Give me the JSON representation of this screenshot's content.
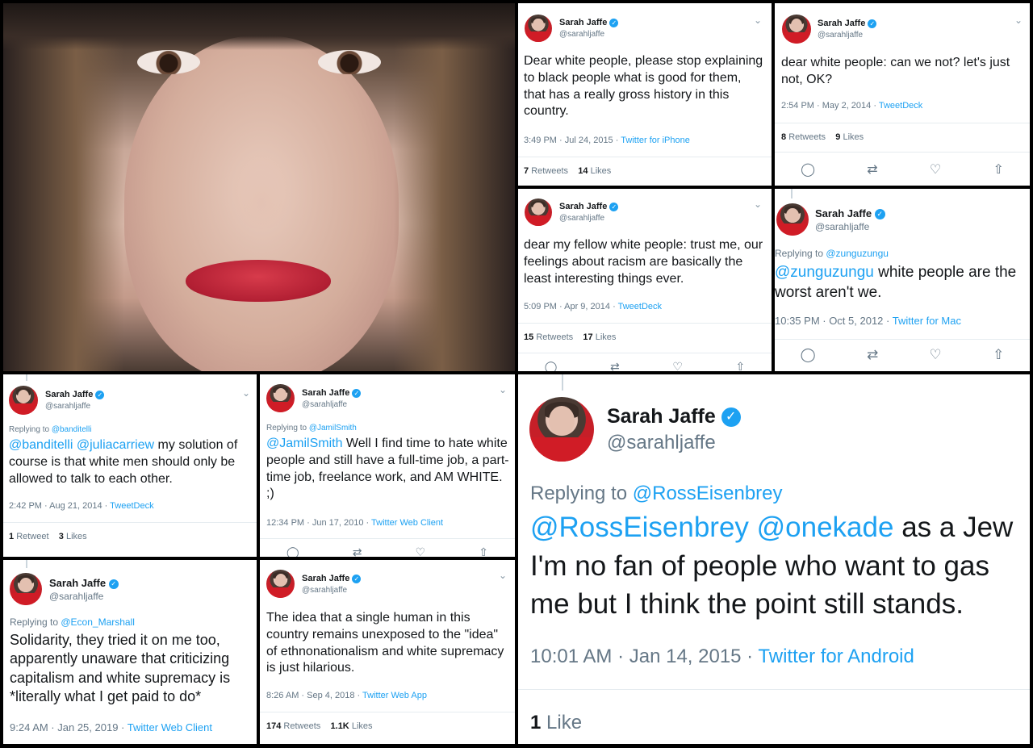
{
  "tweets": [
    {
      "name": "Sarah Jaffe",
      "handle": "@sarahljaffe",
      "reply_prefix": "",
      "reply_to": "",
      "mentions": "",
      "text": "Dear white people, please stop explaining to black people what is good for them, that has a really gross history in this country.",
      "time": "3:49 PM · Jul 24, 2015 · ",
      "source": "Twitter for iPhone",
      "retweets": "7",
      "retweets_label": "Retweets",
      "likes": "14",
      "likes_label": "Likes"
    },
    {
      "name": "Sarah Jaffe",
      "handle": "@sarahljaffe",
      "text": "dear white people: can we not? let's just not, OK?",
      "time": "2:54 PM · May 2, 2014 · ",
      "source": "TweetDeck",
      "retweets": "8",
      "retweets_label": "Retweets",
      "likes": "9",
      "likes_label": "Likes"
    },
    {
      "name": "Sarah Jaffe",
      "handle": "@sarahljaffe",
      "text": "dear my fellow white people: trust me, our feelings about racism are basically the least interesting things ever.",
      "time": "5:09 PM · Apr 9, 2014 · ",
      "source": "TweetDeck",
      "retweets": "15",
      "retweets_label": "Retweets",
      "likes": "17",
      "likes_label": "Likes"
    },
    {
      "name": "Sarah Jaffe",
      "handle": "@sarahljaffe",
      "reply_prefix": "Replying to ",
      "reply_to": "@zunguzungu",
      "mentions": "@zunguzungu",
      "text": " white people are the worst aren't we.",
      "time": "10:35 PM · Oct 5, 2012 · ",
      "source": "Twitter for Mac"
    },
    {
      "name": "Sarah Jaffe",
      "handle": "@sarahljaffe",
      "reply_prefix": "Replying to ",
      "reply_to": "@banditelli",
      "mentions": "@banditelli @juliacarriew",
      "text": " my solution of course is that white men should only be allowed to talk to each other.",
      "time": "2:42 PM · Aug 21, 2014 · ",
      "source": "TweetDeck",
      "retweets": "1",
      "retweets_label": "Retweet",
      "likes": "3",
      "likes_label": "Likes"
    },
    {
      "name": "Sarah Jaffe",
      "handle": "@sarahljaffe",
      "reply_prefix": "Replying to ",
      "reply_to": "@JamilSmith",
      "mentions": "@JamilSmith",
      "text": " Well I find time to hate white people and still have a full-time job, a part-time job, freelance work, and AM WHITE. ;)",
      "time": "12:34 PM · Jun 17, 2010 · ",
      "source": "Twitter Web Client"
    },
    {
      "name": "Sarah Jaffe",
      "handle": "@sarahljaffe",
      "reply_prefix": "Replying to ",
      "reply_to": "@Econ_Marshall",
      "text": "Solidarity, they tried it on me too, apparently unaware that criticizing capitalism and white supremacy is *literally what I get paid to do*",
      "time": "9:24 AM · Jan 25, 2019 · ",
      "source": "Twitter Web Client"
    },
    {
      "name": "Sarah Jaffe",
      "handle": "@sarahljaffe",
      "text": "The idea that a single human in this country remains unexposed to the \"idea\" of ethnonationalism and white supremacy is just hilarious.",
      "time": "8:26 AM · Sep 4, 2018 · ",
      "source": "Twitter Web App",
      "retweets": "174",
      "retweets_label": "Retweets",
      "likes": "1.1K",
      "likes_label": "Likes"
    },
    {
      "name": "Sarah Jaffe",
      "handle": "@sarahljaffe",
      "reply_prefix": "Replying to ",
      "reply_to": "@RossEisenbrey",
      "mentions": "@RossEisenbrey @onekade",
      "text": " as a Jew I'm no fan of people who want to gas me but I think the point still stands.",
      "time": "10:01 AM · Jan 14, 2015 · ",
      "source": "Twitter for Android",
      "likes": "1",
      "likes_label": "Like"
    }
  ],
  "icons": {
    "verified": "✓",
    "chevron": "⌄",
    "reply": "◯",
    "retweet": "⇄",
    "like": "♡",
    "share": "⇧"
  },
  "colors": {
    "link": "#1da1f2",
    "verified": "#1da1f2",
    "muted": "#657786",
    "background": "#000000"
  }
}
